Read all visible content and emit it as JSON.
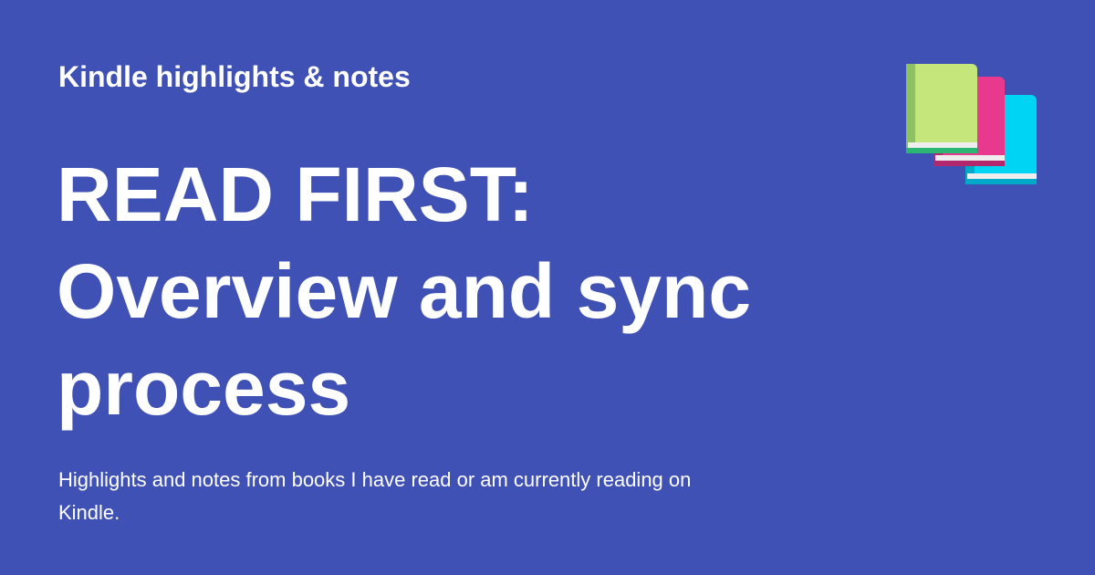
{
  "header": {
    "site_name": "Kindle highlights & notes"
  },
  "main": {
    "title_lines": [
      "READ FIRST:",
      "Overview and sync",
      "process"
    ],
    "description": "Highlights and notes from books I have read or am currently reading on Kindle."
  },
  "icon": {
    "name": "books-icon",
    "colors": {
      "background": "#3f51b5",
      "book_green": "#c5e67a",
      "book_green_spine": "#8dc163",
      "book_pink": "#e8398f",
      "book_pink_spine": "#b3286d",
      "book_cyan": "#00d4f5",
      "book_cyan_spine": "#00a9c8",
      "pages": "#eeeeee"
    }
  }
}
